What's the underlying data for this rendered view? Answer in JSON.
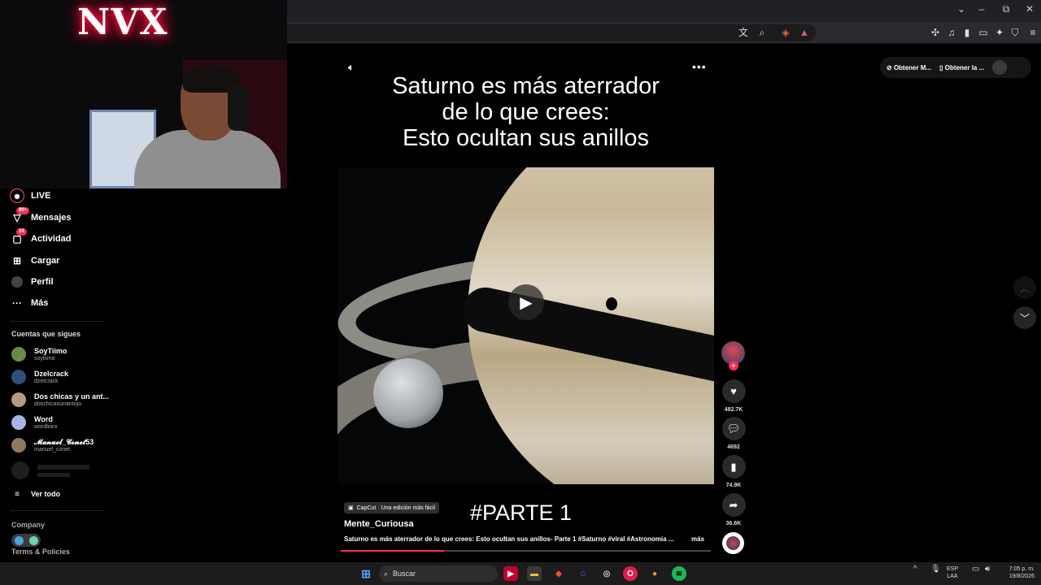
{
  "browser": {
    "window_controls": [
      "⌄",
      "–",
      "⧉",
      "✕"
    ],
    "toolbar_icons": [
      "translate-icon",
      "zoom-icon",
      "brave-shield-icon",
      "brave-rewards-icon",
      "extensions-icon",
      "media-icon",
      "sidebar-icon",
      "wallet-icon",
      "leo-icon",
      "vpn-icon",
      "menu-icon"
    ]
  },
  "webcam": {
    "neon_sign": "NVX"
  },
  "sidebar": {
    "nav": [
      {
        "label": "LIVE",
        "icon": "live-icon"
      },
      {
        "label": "Mensajes",
        "icon": "messages-icon",
        "badge": "99+"
      },
      {
        "label": "Actividad",
        "icon": "activity-icon",
        "badge": "34"
      },
      {
        "label": "Cargar",
        "icon": "upload-icon"
      },
      {
        "label": "Perfil",
        "icon": "profile-icon"
      },
      {
        "label": "Más",
        "icon": "more-icon"
      }
    ],
    "following_title": "Cuentas que sigues",
    "following": [
      {
        "name": "SoyTiimo",
        "user": "soytiimo",
        "color": "#6b8a4a"
      },
      {
        "name": "Dzelcrack",
        "user": "dzelcrack",
        "color": "#2c4f7c"
      },
      {
        "name": "Dos chicas y un ant...",
        "user": "doschicasunantojo",
        "color": "#b59b82"
      },
      {
        "name": "Word",
        "user": "wordloiro",
        "color": "#a8b4e6"
      },
      {
        "name": "𝓜𝓪𝓷𝓾𝓮𝓵_𝓒𝓸𝓷𝓮𝓽53",
        "user": "manuel_conet",
        "color": "#8a7a60"
      }
    ],
    "see_all": "Ver todo",
    "company": "Company",
    "terms": "Terms & Policies"
  },
  "video": {
    "title_lines": [
      "Saturno es más aterrador",
      "de lo que crees:",
      "Esto ocultan sus anillos"
    ],
    "hashtag_overlay": "#PARTE 1",
    "capcut_tag": "CapCut · Una edición más fácil",
    "author": "Mente_Curiousa",
    "caption": "Saturno es más aterrador de lo que crees: Esto ocultan sus anillos- Parte 1 #Saturno #viral #Astronomia ...",
    "more": "más",
    "progress_fraction": 0.28
  },
  "actions": {
    "likes": "482.7K",
    "comments": "4692",
    "saves": "74.9K",
    "shares": "36.6K"
  },
  "topright": {
    "get_app_1": "Obtener M...",
    "get_app_2": "Obtener la ..."
  },
  "taskbar": {
    "search_placeholder": "Buscar",
    "lang_1": "ESP",
    "lang_2": "LAA",
    "time": "7:05 p. m.",
    "date": "19/8/2026"
  }
}
